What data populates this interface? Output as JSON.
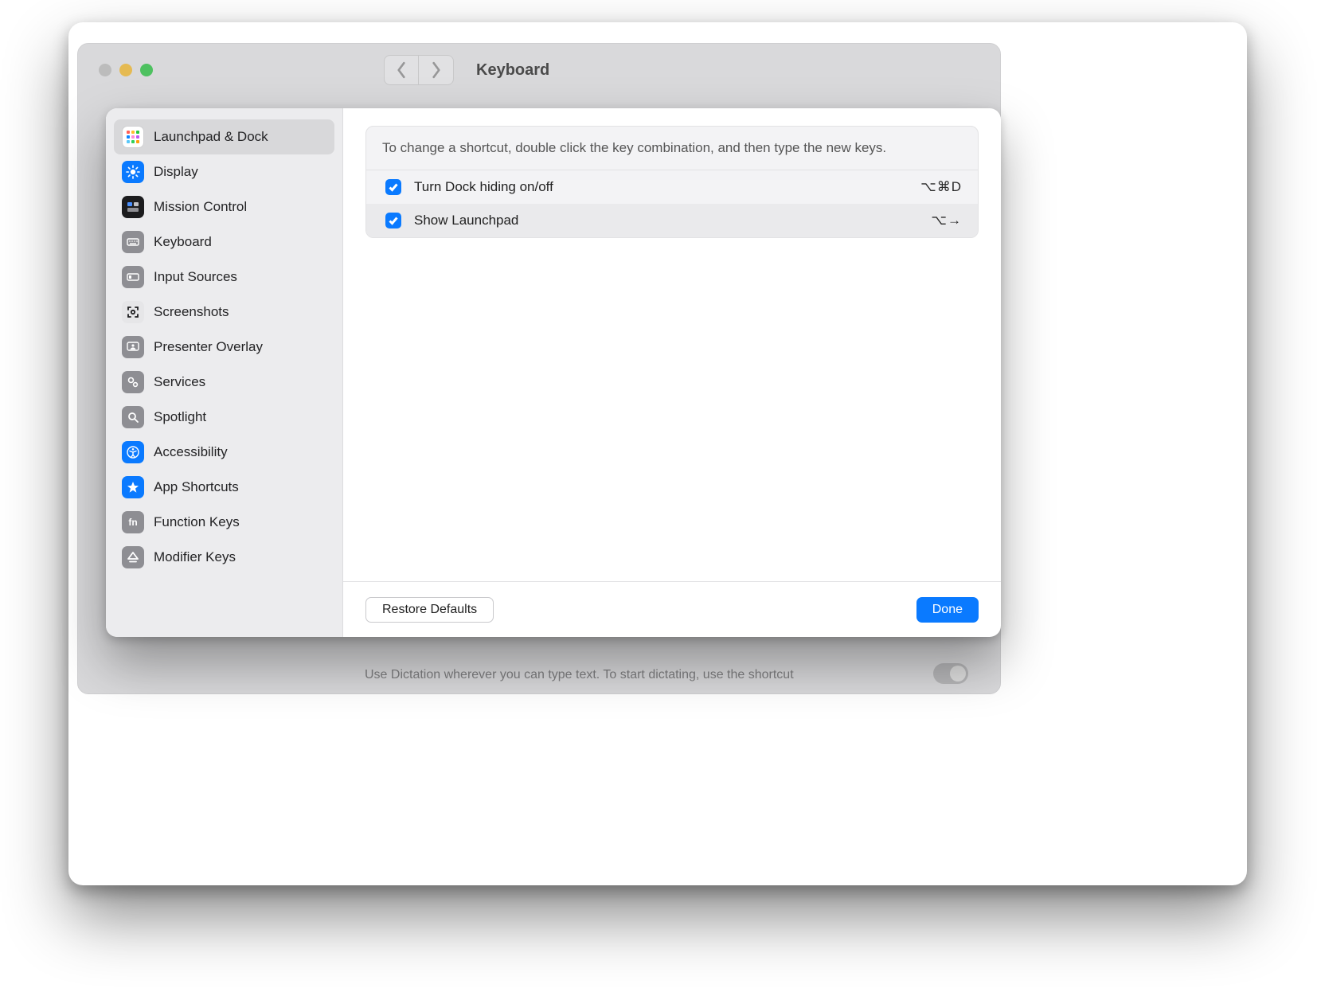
{
  "parent_window": {
    "title": "Keyboard",
    "dictation_hint": "Use Dictation wherever you can type text. To start dictating, use the shortcut"
  },
  "sheet": {
    "help_text": "To change a shortcut, double click the key combination, and then type the new keys.",
    "sidebar": [
      {
        "id": "launchpad-dock",
        "label": "Launchpad & Dock",
        "selected": true
      },
      {
        "id": "display",
        "label": "Display"
      },
      {
        "id": "mission-control",
        "label": "Mission Control"
      },
      {
        "id": "keyboard",
        "label": "Keyboard"
      },
      {
        "id": "input-sources",
        "label": "Input Sources"
      },
      {
        "id": "screenshots",
        "label": "Screenshots"
      },
      {
        "id": "presenter",
        "label": "Presenter Overlay"
      },
      {
        "id": "services",
        "label": "Services"
      },
      {
        "id": "spotlight",
        "label": "Spotlight"
      },
      {
        "id": "accessibility",
        "label": "Accessibility"
      },
      {
        "id": "app-shortcuts",
        "label": "App Shortcuts"
      },
      {
        "id": "function-keys",
        "label": "Function Keys"
      },
      {
        "id": "modifier-keys",
        "label": "Modifier Keys"
      }
    ],
    "shortcuts": [
      {
        "enabled": true,
        "label": "Turn Dock hiding on/off",
        "keys": "⌥⌘D"
      },
      {
        "enabled": true,
        "label": "Show Launchpad",
        "keys": "⌥→"
      }
    ],
    "buttons": {
      "restore": "Restore Defaults",
      "done": "Done"
    }
  }
}
